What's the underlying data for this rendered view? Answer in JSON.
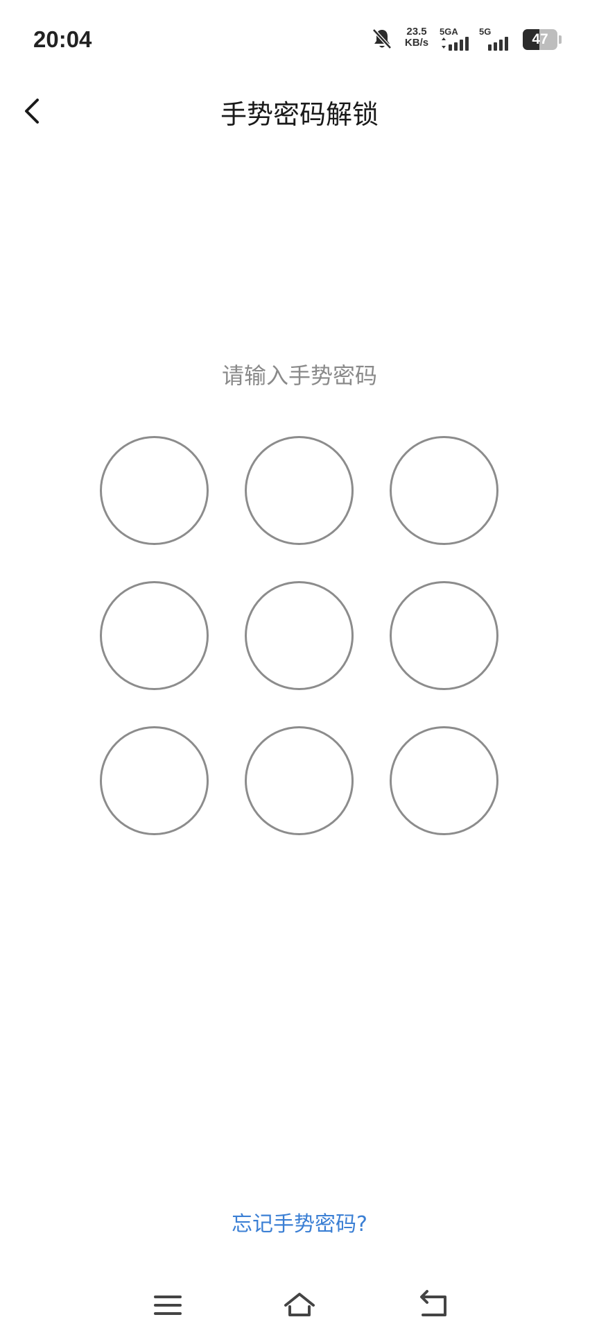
{
  "status_bar": {
    "time": "20:04",
    "net_speed_value": "23.5",
    "net_speed_unit": "KB/s",
    "sim1_label": "5GA",
    "sim2_label": "5G",
    "battery_level": "47",
    "battery_fraction": 0.47,
    "icons": [
      "bell-muted-icon",
      "signal-icon",
      "battery-icon"
    ]
  },
  "header": {
    "title": "手势密码解锁",
    "back_icon": "chevron-left-icon"
  },
  "prompt": "请输入手势密码",
  "gesture_grid": {
    "rows": 3,
    "cols": 3,
    "selected": [],
    "stroke_color": "#8c8c8c"
  },
  "forgot_link": "忘记手势密码?",
  "colors": {
    "accent": "#3b7fd4",
    "prompt_text": "#8a8a8a",
    "title_text": "#1a1a1a"
  },
  "nav_bar": {
    "buttons": [
      "menu-icon",
      "home-icon",
      "back-icon"
    ]
  }
}
